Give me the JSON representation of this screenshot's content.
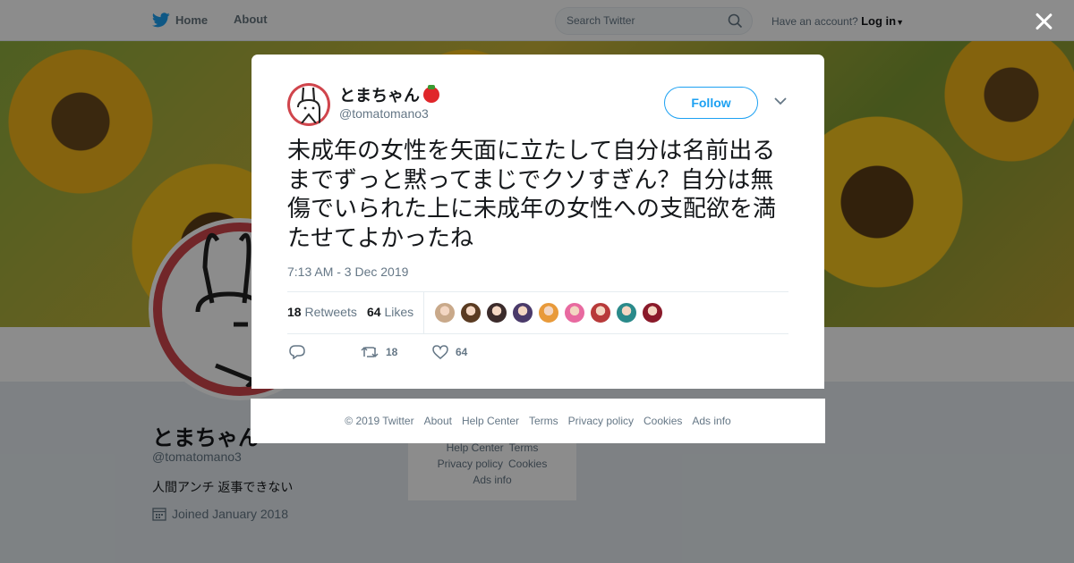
{
  "topbar": {
    "home_label": "Home",
    "about_label": "About",
    "search_placeholder": "Search Twitter",
    "account_prompt": "Have an account?",
    "login_label": "Log in"
  },
  "profile": {
    "name": "とまちゃん",
    "handle": "@tomatomano3",
    "bio": "人間アンチ 返事できない",
    "joined": "Joined January 2018",
    "side_links": [
      "Help Center",
      "Terms",
      "Privacy policy",
      "Cookies",
      "Ads info"
    ]
  },
  "tweet": {
    "author_name": "とまちゃん",
    "author_handle": "@tomatomano3",
    "follow_label": "Follow",
    "text": "未成年の女性を矢面に立たして自分は名前出るまでずっと黙ってまじでクソすぎん？自分は無傷でいられた上に未成年の女性への支配欲を満たせてよかったね",
    "timestamp": "7:13 AM - 3 Dec 2019",
    "retweet_count": "18",
    "retweet_label": "Retweets",
    "like_count": "64",
    "like_label": "Likes",
    "liker_colors": [
      "#c9a98a",
      "#5a3b22",
      "#3b2b2b",
      "#4a3a6a",
      "#e89a3a",
      "#e86aa0",
      "#b83a3a",
      "#2a8a8a",
      "#8a1a2a"
    ],
    "action_retweets": "18",
    "action_likes": "64"
  },
  "footer": {
    "links": [
      "© 2019 Twitter",
      "About",
      "Help Center",
      "Terms",
      "Privacy policy",
      "Cookies",
      "Ads info"
    ]
  }
}
